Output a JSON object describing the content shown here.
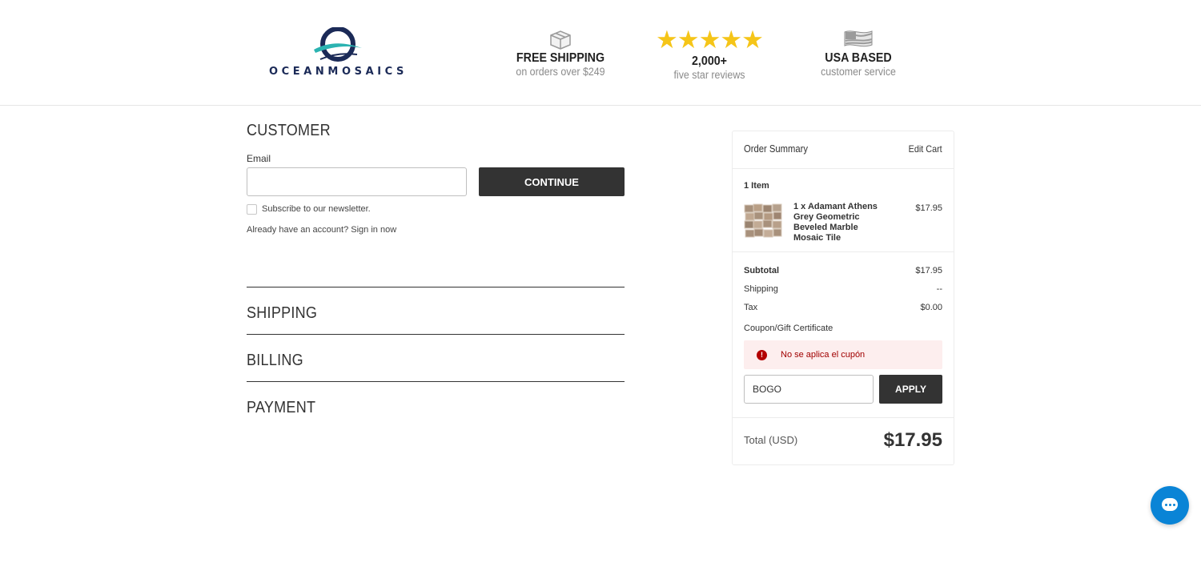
{
  "header": {
    "logo_text": "OCEANMOSAICS",
    "badges": {
      "shipping": {
        "title": "FREE SHIPPING",
        "subtitle": "on orders over $249",
        "icon": "box-icon"
      },
      "reviews": {
        "stars": "★★★★★",
        "title": "2,000+",
        "subtitle": "five star reviews",
        "icon": "star-icon"
      },
      "usa": {
        "title": "USA BASED",
        "subtitle": "customer service",
        "icon": "us-flag-icon"
      }
    }
  },
  "checkout": {
    "customer_title": "CUSTOMER",
    "email_label": "Email",
    "email_value": "",
    "continue_label": "CONTINUE",
    "newsletter_label": "Subscribe to our newsletter.",
    "signin_prefix": "Already have an account?",
    "signin_link": "Sign in now",
    "shipping_title": "SHIPPING",
    "billing_title": "BILLING",
    "payment_title": "PAYMENT"
  },
  "summary": {
    "title": "Order Summary",
    "edit_cart": "Edit Cart",
    "item_count": "1 Item",
    "item": {
      "name": "1 x Adamant Athens Grey Geometric Beveled Marble Mosaic Tile",
      "price": "$17.95"
    },
    "subtotal_label": "Subtotal",
    "subtotal_value": "$17.95",
    "shipping_label": "Shipping",
    "shipping_value": "--",
    "tax_label": "Tax",
    "tax_value": "$0.00",
    "coupon_label": "Coupon/Gift Certificate",
    "coupon_error": "No se aplica el cupón",
    "coupon_value": "BOGO",
    "apply_label": "APPLY",
    "total_label": "Total (USD)",
    "total_value": "$17.95"
  },
  "colors": {
    "brand_navy": "#1b2a57",
    "brand_teal": "#2bb3b1",
    "button_dark": "#333333",
    "star_yellow": "#f5c518",
    "error_red": "#a10000",
    "chat_blue": "#0a84d6"
  }
}
